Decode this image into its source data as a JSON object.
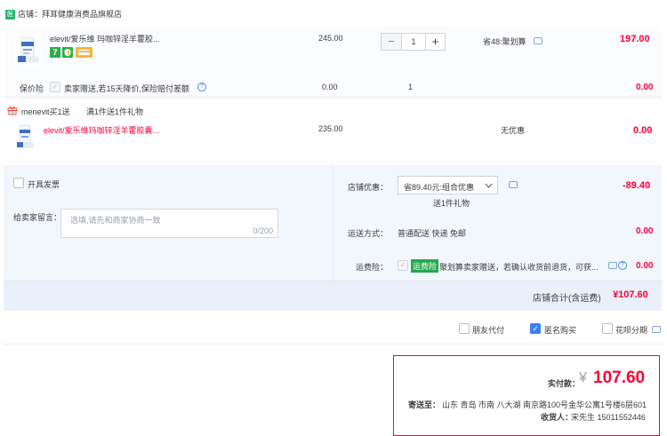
{
  "shop": {
    "badge": "医",
    "name": "店铺：拜耳健康消费品旗舰店"
  },
  "items": [
    {
      "title": "elevit/爱乐维 玛咖锌淫羊藿胶...",
      "price": "245.00",
      "quantity": "1",
      "discount": "省48:聚划算",
      "subtotal": "197.00",
      "tags": [
        "7-icon",
        "shield-icon",
        "card-icon"
      ]
    },
    {
      "promo_label": "menevit买1送",
      "promo_desc": "满1件送1件礼物",
      "title": "elevit/爱乐维玛咖锌淫羊藿胶囊...",
      "price": "235.00",
      "discount": "无优惠",
      "subtotal": "0.00"
    }
  ],
  "insurance": {
    "label": "保价险",
    "desc": "卖家赠送,若15天降价,保险赔付差额",
    "price": "0.00",
    "quantity": "1",
    "subtotal": "0.00"
  },
  "invoice": {
    "label": "开具发票"
  },
  "message": {
    "label": "给卖家留言：",
    "placeholder": "选填,请先和商家协商一致",
    "counter": "0/200"
  },
  "shop_discount": {
    "label": "店铺优惠：",
    "selected": "省89.40元:组合优惠",
    "gift": "送1件礼物",
    "amount": "-89.40"
  },
  "shipping": {
    "label": "运送方式：",
    "method": "普通配送 快递 免邮",
    "amount": "0.00"
  },
  "freight_insurance": {
    "label": "运费险：",
    "tag": "运费险",
    "desc": "聚划算卖家赠送，若确认收货前退货，可获...",
    "amount": "0.00"
  },
  "shop_total": {
    "label": "店铺合计(含运费)",
    "amount": "¥107.60"
  },
  "options": {
    "friend_pay": "朋友代付",
    "anonymous": "匿名购买",
    "installment": "花呗分期"
  },
  "payment": {
    "label": "实付款：",
    "currency": "¥",
    "amount": "107.60",
    "address_label": "寄送至：",
    "address": "山东 青岛 市南 八大湖 南京路100号金华公寓1号楼6层601",
    "receiver_label": "收货人：",
    "receiver": "宋先生 15011552446"
  },
  "colors": {
    "price_red": "#ff0036",
    "check_blue": "#3d7ef4",
    "badge_green": "#2bb673"
  }
}
